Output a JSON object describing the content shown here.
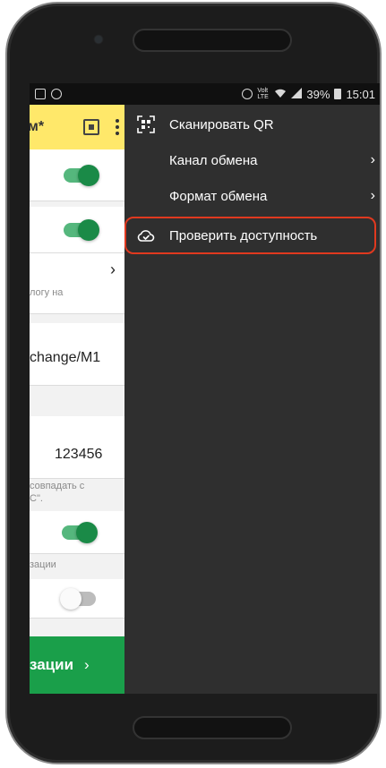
{
  "status_bar": {
    "net_label": "Volt LTE",
    "battery": "39%",
    "time": "15:01"
  },
  "background_app": {
    "title_fragment": "м*",
    "fields": {
      "hint_1": "логу на",
      "value_1": "change/M1",
      "value_2": "123456",
      "hint_2": "совпадать с",
      "hint_2b": "С\".",
      "hint_3": "зации",
      "chevron": "›"
    },
    "switches": [
      {
        "on": true
      },
      {
        "on": true
      },
      {
        "on": true
      },
      {
        "on": false
      }
    ],
    "bottom_button": {
      "label": "зации",
      "arrow": "›"
    }
  },
  "menu": {
    "items": [
      {
        "label": "Сканировать QR",
        "icon": "qr-icon",
        "has_submenu": false
      },
      {
        "label": "Канал обмена",
        "icon": "",
        "has_submenu": true
      },
      {
        "label": "Формат обмена",
        "icon": "",
        "has_submenu": true
      },
      {
        "label": "Проверить доступность",
        "icon": "cloud-check-icon",
        "has_submenu": false,
        "highlighted": true
      }
    ],
    "submenu_chevron": "›"
  },
  "colors": {
    "drawer_bg": "#2f2f2f",
    "toolbar_yellow": "#ffe86a",
    "accent_green": "#1a9f4a",
    "highlight_red": "#e0391f"
  }
}
